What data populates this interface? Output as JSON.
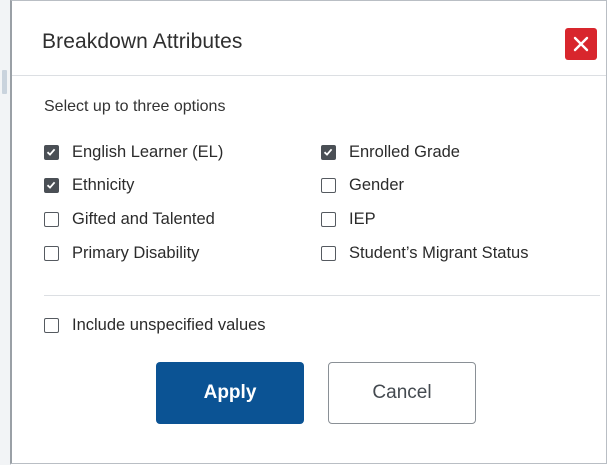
{
  "dialog": {
    "title": "Breakdown Attributes",
    "close_icon": "close-icon",
    "instructions": "Select up to three options",
    "options": [
      {
        "label": "English Learner (EL)",
        "checked": true
      },
      {
        "label": "Enrolled Grade",
        "checked": true
      },
      {
        "label": "Ethnicity",
        "checked": true
      },
      {
        "label": "Gender",
        "checked": false
      },
      {
        "label": "Gifted and Talented",
        "checked": false
      },
      {
        "label": "IEP",
        "checked": false
      },
      {
        "label": "Primary Disability",
        "checked": false
      },
      {
        "label": "Student’s Migrant Status",
        "checked": false
      }
    ],
    "include_unspecified": {
      "label": "Include unspecified values",
      "checked": false
    },
    "apply_label": "Apply",
    "cancel_label": "Cancel"
  },
  "colors": {
    "close_bg": "#d8262d",
    "apply_bg": "#0b5394",
    "checkbox_checked": "#4a4f55"
  }
}
